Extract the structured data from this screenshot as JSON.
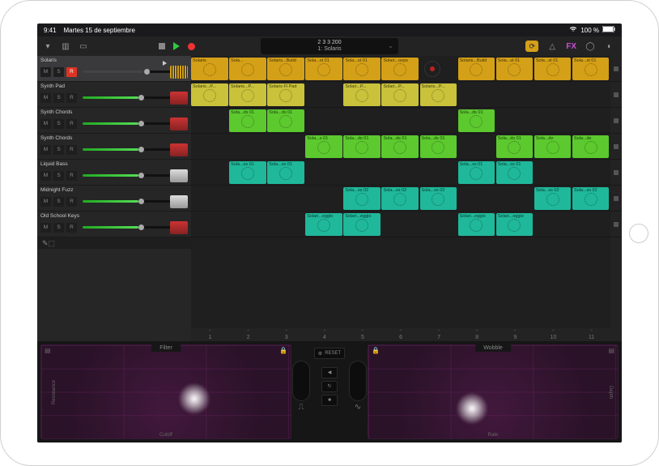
{
  "status": {
    "time": "9:41",
    "date": "Martes 15 de septiembre",
    "battery": "100 %"
  },
  "lcd": {
    "top": "2  3  3  200",
    "bottom": "1: Solaris"
  },
  "fx_label": "FX",
  "tracks": [
    {
      "name": "Solaris",
      "rec": true,
      "icon": "pads",
      "sel": true
    },
    {
      "name": "Synth Pad",
      "rec": false,
      "icon": "keys"
    },
    {
      "name": "Synth Chords",
      "rec": false,
      "icon": "keys"
    },
    {
      "name": "Synth Chords",
      "rec": false,
      "icon": "keys"
    },
    {
      "name": "Liquid Bass",
      "rec": false,
      "icon": "amp"
    },
    {
      "name": "Midnight Fuzz",
      "rec": false,
      "icon": "amp"
    },
    {
      "name": "Old School Keys",
      "rec": false,
      "icon": "keys"
    }
  ],
  "btns": {
    "m": "M",
    "s": "S",
    "r": "R"
  },
  "columns": [
    "1",
    "2",
    "3",
    "4",
    "5",
    "6",
    "7",
    "8",
    "9",
    "10",
    "11"
  ],
  "clips": {
    "r0": [
      {
        "c": 0,
        "cls": "ylw",
        "t": "Solaris"
      },
      {
        "c": 1,
        "cls": "ylw",
        "t": "Sola..."
      },
      {
        "c": 2,
        "cls": "ylw",
        "t": "Solaris...Build"
      },
      {
        "c": 3,
        "cls": "ylw",
        "t": "Sola...st 01"
      },
      {
        "c": 4,
        "cls": "ylw",
        "t": "Sola...st 01"
      },
      {
        "c": 5,
        "cls": "ylw",
        "t": "Solari...oops"
      },
      {
        "c": 7,
        "cls": "ylw",
        "t": "Solaris...Build"
      },
      {
        "c": 8,
        "cls": "ylw",
        "t": "Sola...st 01"
      },
      {
        "c": 9,
        "cls": "ylw",
        "t": "Sola...st 01"
      },
      {
        "c": 10,
        "cls": "ylw",
        "t": "Sola...st 01"
      }
    ],
    "r1": [
      {
        "c": 0,
        "cls": "ylw2",
        "t": "Solaris...P..."
      },
      {
        "c": 1,
        "cls": "ylw2",
        "t": "Solaris...P..."
      },
      {
        "c": 2,
        "cls": "ylw2",
        "t": "Solaris Fl Pad"
      },
      {
        "c": 4,
        "cls": "ylw2",
        "t": "Solari...P..."
      },
      {
        "c": 5,
        "cls": "ylw2",
        "t": "Solari...P..."
      },
      {
        "c": 6,
        "cls": "ylw2",
        "t": "Solaris...P..."
      }
    ],
    "r2": [
      {
        "c": 1,
        "cls": "grn",
        "t": "Sola...ds 01"
      },
      {
        "c": 2,
        "cls": "grn",
        "t": "Sola...ds 01"
      },
      {
        "c": 7,
        "cls": "grn",
        "t": "Sola...ds 01"
      }
    ],
    "r3": [
      {
        "c": 3,
        "cls": "grn",
        "t": "Sola...s 01"
      },
      {
        "c": 4,
        "cls": "grn",
        "t": "Sola...ds 01"
      },
      {
        "c": 5,
        "cls": "grn",
        "t": "Sola...ds 01"
      },
      {
        "c": 6,
        "cls": "grn",
        "t": "Sola...ds 01"
      },
      {
        "c": 8,
        "cls": "grn",
        "t": "Sola...ds 01"
      },
      {
        "c": 9,
        "cls": "grn",
        "t": "Sola...de"
      },
      {
        "c": 10,
        "cls": "grn",
        "t": "Sola...de"
      }
    ],
    "r4": [
      {
        "c": 1,
        "cls": "teal",
        "t": "Sola...ss 01"
      },
      {
        "c": 2,
        "cls": "teal",
        "t": "Sola...ss 01"
      },
      {
        "c": 7,
        "cls": "teal",
        "t": "Sola...ss 01"
      },
      {
        "c": 8,
        "cls": "teal",
        "t": "Sola...ss 01"
      }
    ],
    "r5": [
      {
        "c": 4,
        "cls": "teal",
        "t": "Sola...ss 02"
      },
      {
        "c": 5,
        "cls": "teal",
        "t": "Sola...ss 02"
      },
      {
        "c": 6,
        "cls": "teal",
        "t": "Sola...ss 02"
      },
      {
        "c": 9,
        "cls": "teal",
        "t": "Sola...ss 02"
      },
      {
        "c": 10,
        "cls": "teal",
        "t": "Sola...ss 02"
      }
    ],
    "r6": [
      {
        "c": 3,
        "cls": "teal",
        "t": "Solari...eggio"
      },
      {
        "c": 4,
        "cls": "teal",
        "t": "Solari...eggio"
      },
      {
        "c": 7,
        "cls": "teal",
        "t": "Solari...eggio"
      },
      {
        "c": 8,
        "cls": "teal",
        "t": "Solari...eggio"
      }
    ]
  },
  "remix": {
    "left": {
      "title": "Filter",
      "xlabel": "Cutoff",
      "ylabel": "Resonance",
      "blob": [
        55,
        40
      ]
    },
    "right": {
      "title": "Wobble",
      "xlabel": "Rate",
      "ylabel": "Depth",
      "blob": [
        35,
        50
      ]
    },
    "reset": "RESET"
  }
}
